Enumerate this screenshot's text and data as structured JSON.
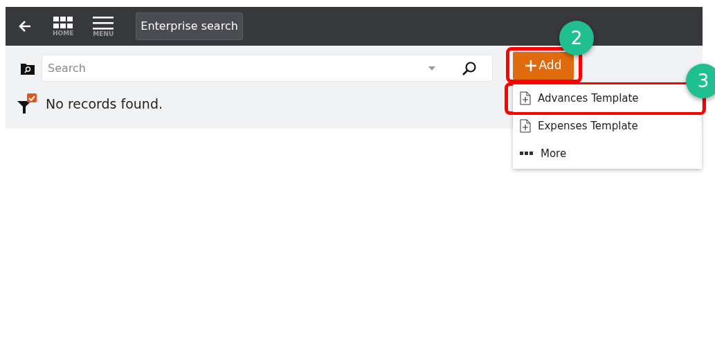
{
  "header": {
    "nav": [
      {
        "kind": "back"
      },
      {
        "kind": "home",
        "label": "HOME"
      },
      {
        "kind": "menu",
        "label": "MENU"
      }
    ],
    "title": "Enterprise search"
  },
  "search": {
    "placeholder": "Search"
  },
  "status": "No records found.",
  "add_button": {
    "label": "Add",
    "highlighted": true,
    "callout": "2"
  },
  "add_menu": [
    {
      "kind": "template",
      "label": "Advances Template",
      "highlighted": true,
      "callout": "3"
    },
    {
      "kind": "template",
      "label": "Expenses Template",
      "highlighted": false
    },
    {
      "kind": "more",
      "label": "More",
      "highlighted": false
    }
  ]
}
